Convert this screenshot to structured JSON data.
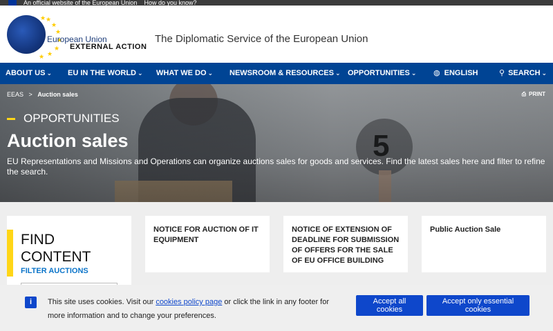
{
  "top_bar": {
    "text": "An official website of the European Union",
    "link": "How do you know?"
  },
  "header": {
    "brand_line1": "European Union",
    "brand_line2": "EXTERNAL ACTION",
    "tagline": "The Diplomatic Service of the European Union"
  },
  "nav": {
    "items": [
      {
        "label": "ABOUT US"
      },
      {
        "label": "EU IN THE WORLD"
      },
      {
        "label": "WHAT WE DO"
      },
      {
        "label": "NEWSROOM & RESOURCES"
      },
      {
        "label": "OPPORTUNITIES"
      },
      {
        "label": "ENGLISH"
      },
      {
        "label": "SEARCH"
      }
    ]
  },
  "hero": {
    "breadcrumb_root": "EEAS",
    "breadcrumb_sep": ">",
    "breadcrumb_current": "Auction sales",
    "print_label": "PRINT",
    "section": "OPPORTUNITIES",
    "title": "Auction sales",
    "description": "EU Representations and Missions and Operations can organize auctions sales for goods and services. Find the latest sales here and filter to refine the search.",
    "paddle_number": "5"
  },
  "find": {
    "title": "FIND CONTENT",
    "filter_label": "FILTER AUCTIONS"
  },
  "cards": [
    {
      "title": "NOTICE FOR AUCTION OF IT EQUIPMENT"
    },
    {
      "title": "NOTICE OF EXTENSION OF DEADLINE FOR SUBMISSION OF OFFERS FOR THE SALE OF EU OFFICE BUILDING"
    },
    {
      "title": "Public Auction Sale"
    }
  ],
  "cookie": {
    "info_glyph": "i",
    "text_before": "This site uses cookies. Visit our ",
    "link": "cookies policy page",
    "text_after": " or click the link in any footer for more information and to change your preferences.",
    "accept_all": "Accept all cookies",
    "accept_essential": "Accept only essential cookies"
  },
  "colors": {
    "nav_bg": "#004494",
    "accent_yellow": "#ffd617",
    "button_blue": "#0e47cb",
    "link_blue": "#0b74c9"
  }
}
